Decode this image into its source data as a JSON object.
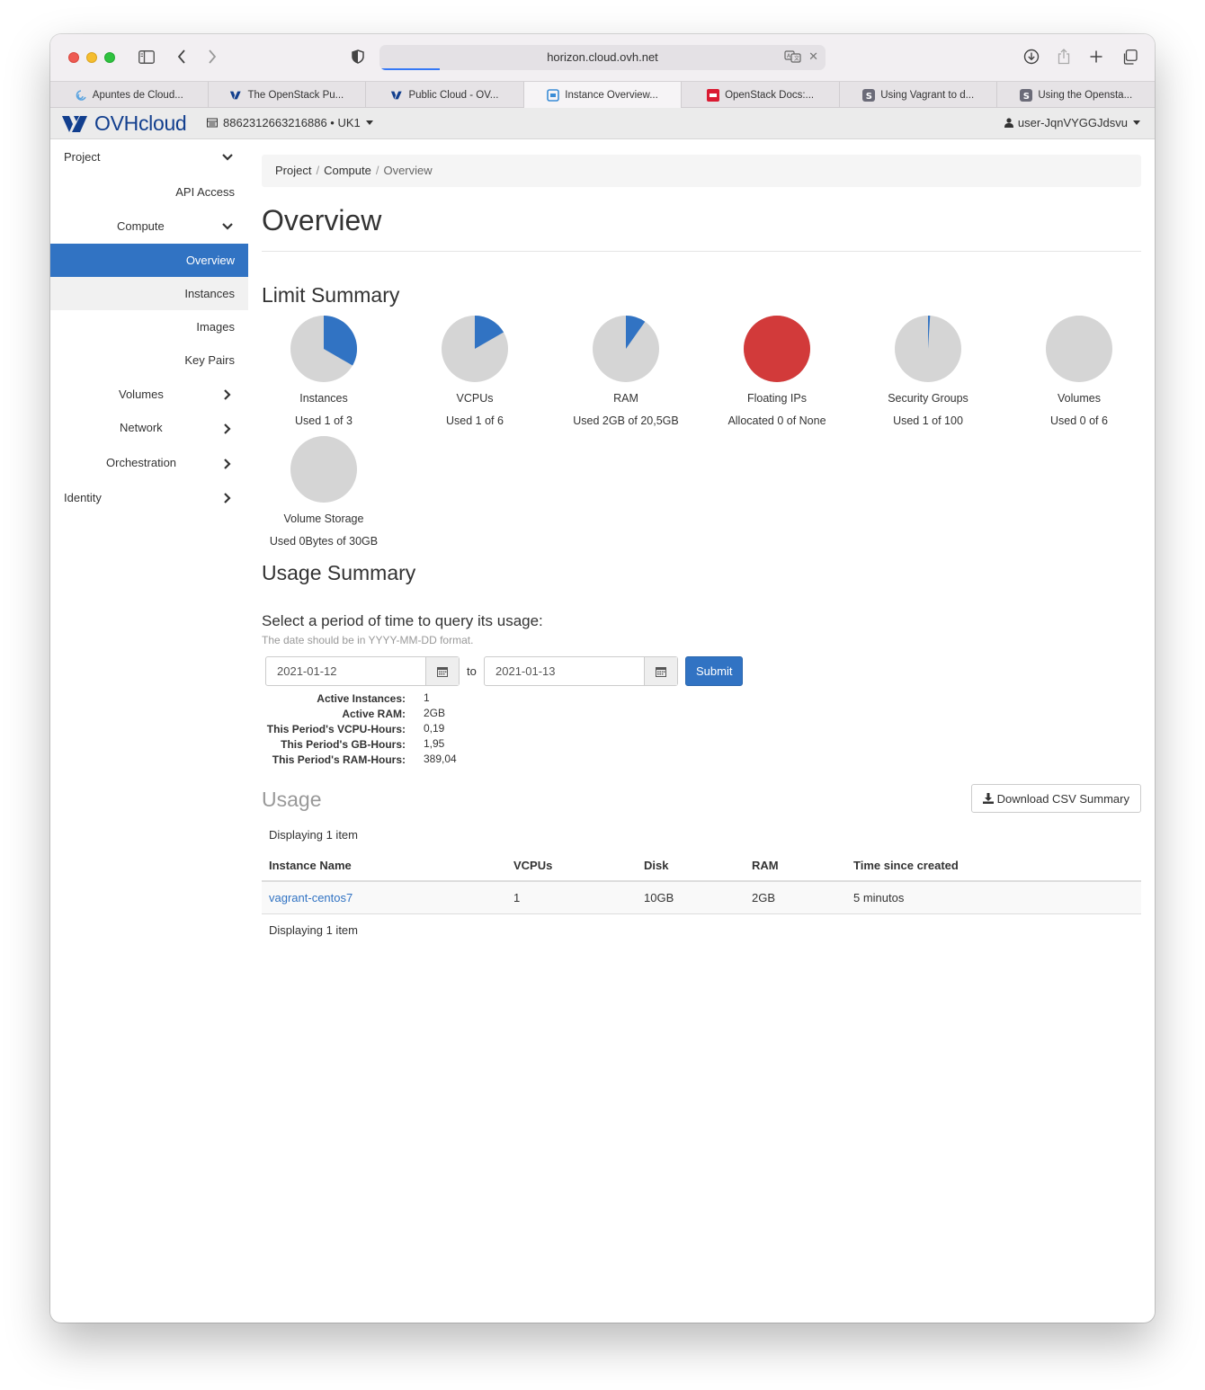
{
  "browser": {
    "url": "horizon.cloud.ovh.net",
    "tabs": [
      {
        "label": "Apuntes de Cloud...",
        "favicon": "cloud-icon",
        "active": false
      },
      {
        "label": "The OpenStack Pu...",
        "favicon": "ovh-icon",
        "active": false
      },
      {
        "label": "Public Cloud - OV...",
        "favicon": "ovh-icon",
        "active": false
      },
      {
        "label": "Instance Overview...",
        "favicon": "openstack-icon",
        "active": true
      },
      {
        "label": "OpenStack Docs:...",
        "favicon": "openstack-red-icon",
        "active": false
      },
      {
        "label": "Using Vagrant to d...",
        "favicon": "s-icon",
        "active": false
      },
      {
        "label": "Using the Opensta...",
        "favicon": "s-icon",
        "active": false
      }
    ]
  },
  "header": {
    "logo_text": "OVHcloud",
    "project": "8862312663216886 • UK1",
    "user": "user-JqnVYGGJdsvu"
  },
  "sidebar": {
    "project": "Project",
    "api_access": "API Access",
    "compute": "Compute",
    "overview": "Overview",
    "instances": "Instances",
    "images": "Images",
    "key_pairs": "Key Pairs",
    "volumes": "Volumes",
    "network": "Network",
    "orchestration": "Orchestration",
    "identity": "Identity"
  },
  "breadcrumb": {
    "project": "Project",
    "compute": "Compute",
    "current": "Overview"
  },
  "page_title": "Overview",
  "limit_summary": {
    "title": "Limit Summary",
    "items": [
      {
        "name": "Instances",
        "used_text": "Used 1 of 3",
        "fraction": 0.3333,
        "color": "#3173c3"
      },
      {
        "name": "VCPUs",
        "used_text": "Used 1 of 6",
        "fraction": 0.1667,
        "color": "#3173c3"
      },
      {
        "name": "RAM",
        "used_text": "Used 2GB of 20,5GB",
        "fraction": 0.0976,
        "color": "#3173c3"
      },
      {
        "name": "Floating IPs",
        "used_text": "Allocated 0 of None",
        "fraction": 1.0,
        "color": "#d23a3a"
      },
      {
        "name": "Security Groups",
        "used_text": "Used 1 of 100",
        "fraction": 0.01,
        "color": "#3173c3"
      },
      {
        "name": "Volumes",
        "used_text": "Used 0 of 6",
        "fraction": 0.0,
        "color": "#3173c3"
      },
      {
        "name": "Volume Storage",
        "used_text": "Used 0Bytes of 30GB",
        "fraction": 0.0,
        "color": "#3173c3"
      }
    ],
    "empty_color": "#d5d5d5"
  },
  "usage_summary": {
    "title": "Usage Summary",
    "query_title": "Select a period of time to query its usage:",
    "query_help": "The date should be in YYYY-MM-DD format.",
    "start_date": "2021-01-12",
    "to_label": "to",
    "end_date": "2021-01-13",
    "submit": "Submit",
    "stats": [
      {
        "label": "Active Instances:",
        "value": "1"
      },
      {
        "label": "Active RAM:",
        "value": "2GB"
      },
      {
        "label": "This Period's VCPU-Hours:",
        "value": "0,19"
      },
      {
        "label": "This Period's GB-Hours:",
        "value": "1,95"
      },
      {
        "label": "This Period's RAM-Hours:",
        "value": "389,04"
      }
    ]
  },
  "usage": {
    "title": "Usage",
    "download_label": "Download CSV Summary",
    "displaying": "Displaying 1 item",
    "columns": [
      "Instance Name",
      "VCPUs",
      "Disk",
      "RAM",
      "Time since created"
    ],
    "rows": [
      [
        "vagrant-centos7",
        "1",
        "10GB",
        "2GB",
        "5 minutos"
      ]
    ]
  }
}
